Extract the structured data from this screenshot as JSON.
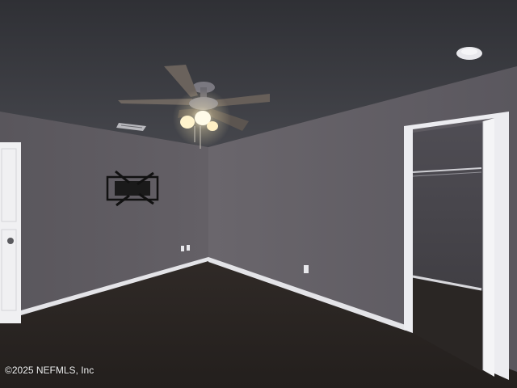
{
  "photo": {
    "subject": "empty bedroom with ceiling fan, wall-mounted TV bracket, and open walk-in closet",
    "watermark": "©2025 NEFMLS, Inc"
  },
  "colors": {
    "ceiling": "#3a3b40",
    "left_wall": "#5a575d",
    "right_wall": "#5e5a61",
    "carpet": "#2b2624",
    "trim": "#e6e6ea",
    "closet_interior": "#4b4a50"
  }
}
